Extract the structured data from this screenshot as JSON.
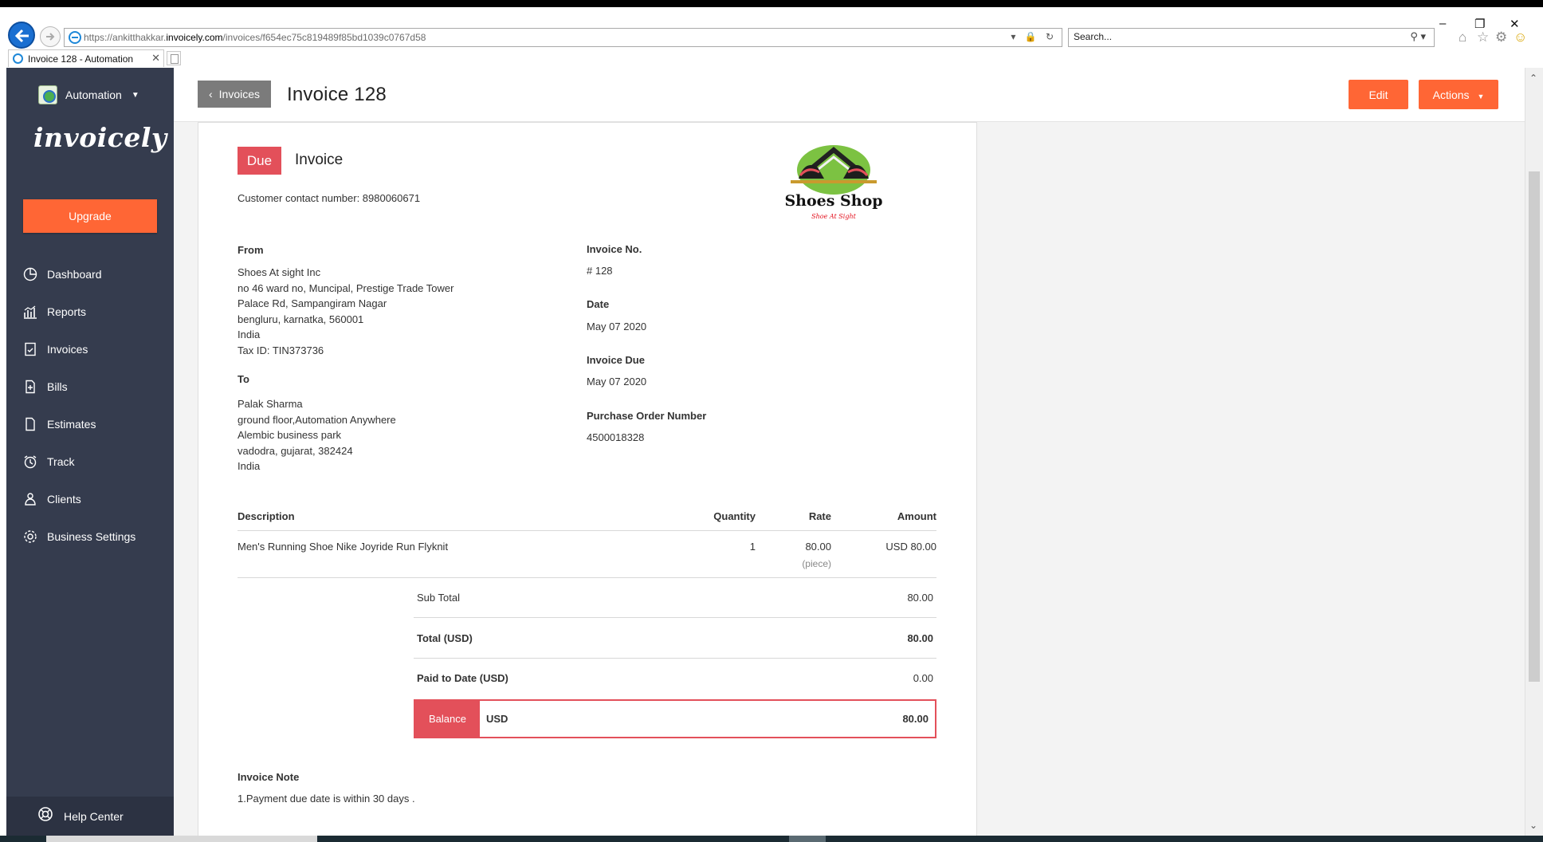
{
  "browser": {
    "url_prefix": "https://ankitthakkar.",
    "url_host": "invoicely.com",
    "url_path": "/invoices/f654ec75c819489f85bd1039c0767d58",
    "search_placeholder": "Search...",
    "tab_title": "Invoice 128 - Automation"
  },
  "sidebar": {
    "org_name": "Automation",
    "brand": "invoicely",
    "upgrade_label": "Upgrade",
    "items": [
      {
        "label": "Dashboard"
      },
      {
        "label": "Reports"
      },
      {
        "label": "Invoices"
      },
      {
        "label": "Bills"
      },
      {
        "label": "Estimates"
      },
      {
        "label": "Track"
      },
      {
        "label": "Clients"
      },
      {
        "label": "Business Settings"
      }
    ],
    "help_label": "Help Center"
  },
  "header": {
    "back_label": "Invoices",
    "title": "Invoice 128",
    "edit_label": "Edit",
    "actions_label": "Actions"
  },
  "invoice": {
    "status": "Due",
    "heading": "Invoice",
    "contact_line": "Customer contact number: 8980060671",
    "logo_text": "Shoes Shop",
    "logo_tagline": "Shoe At Sight",
    "from_label": "From",
    "from_lines": [
      "Shoes At sight Inc",
      "no 46 ward no, Muncipal, Prestige Trade Tower",
      "Palace Rd, Sampangiram Nagar",
      "bengluru, karnatka, 560001",
      "India",
      "Tax ID: TIN373736"
    ],
    "to_label": "To",
    "to_lines": [
      "Palak Sharma",
      "ground floor,Automation Anywhere",
      "Alembic business park",
      "vadodra, gujarat, 382424",
      "India"
    ],
    "invoice_no_label": "Invoice No.",
    "invoice_no": "# 128",
    "date_label": "Date",
    "date": "May 07 2020",
    "due_label": "Invoice Due",
    "due": "May 07 2020",
    "po_label": "Purchase Order Number",
    "po": "4500018328",
    "table": {
      "headers": [
        "Description",
        "Quantity",
        "Rate",
        "Amount"
      ],
      "rows": [
        {
          "description": "Men's Running Shoe Nike Joyride Run Flyknit",
          "quantity": "1",
          "rate": "80.00",
          "unit": "(piece)",
          "amount": "USD 80.00"
        }
      ]
    },
    "subtotal_label": "Sub Total",
    "subtotal": "80.00",
    "total_label": "Total (USD)",
    "total": "80.00",
    "paid_label": "Paid to Date (USD)",
    "paid": "0.00",
    "balance_label": "Balance",
    "balance_currency": "USD",
    "balance": "80.00",
    "note_label": "Invoice Note",
    "note": "1.Payment due date is within 30 days ."
  },
  "colors": {
    "accent": "#ff6635",
    "due_red": "#e3505a",
    "sidebar_bg": "#353c4e",
    "back_button": "#7b7b7b"
  },
  "icons": {
    "sidebar": [
      "dashboard-icon",
      "reports-icon",
      "invoices-icon",
      "bills-icon",
      "estimates-icon",
      "track-icon",
      "clients-icon",
      "settings-icon"
    ],
    "help": "help-center-icon"
  }
}
